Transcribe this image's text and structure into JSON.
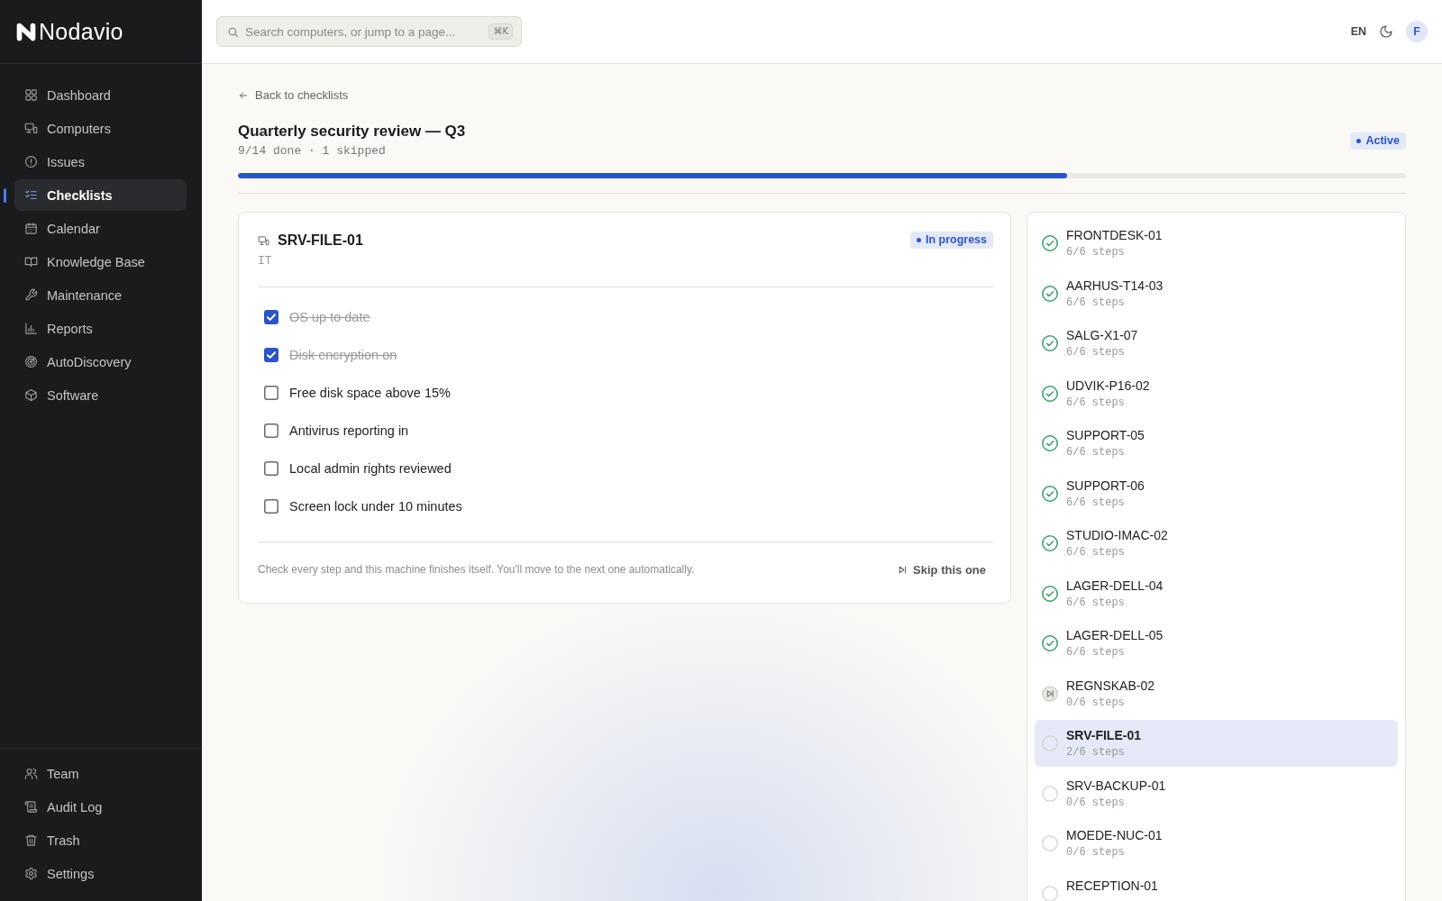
{
  "sidebar": {
    "brand": "Nodavio",
    "nav": [
      {
        "label": "Dashboard",
        "selected": false
      },
      {
        "label": "Computers",
        "selected": false
      },
      {
        "label": "Issues",
        "selected": false
      },
      {
        "label": "Checklists",
        "selected": true
      },
      {
        "label": "Calendar",
        "selected": false
      },
      {
        "label": "Knowledge Base",
        "selected": false
      },
      {
        "label": "Maintenance",
        "selected": false
      },
      {
        "label": "Reports",
        "selected": false
      },
      {
        "label": "AutoDiscovery",
        "selected": false
      },
      {
        "label": "Software",
        "selected": false
      }
    ],
    "footer_nav": [
      {
        "label": "Team",
        "selected": false
      },
      {
        "label": "Audit Log",
        "selected": false
      },
      {
        "label": "Trash",
        "selected": false
      },
      {
        "label": "Settings",
        "selected": false
      }
    ]
  },
  "topbar": {
    "search": {
      "placeholder": "Search computers, or jump to a page...",
      "shortcut": "⌘K"
    },
    "language": "EN",
    "avatar": "F"
  },
  "header": {
    "back_link": "Back to checklists",
    "title": "Quarterly security review — Q3",
    "summary": "9/14 done · 1 skipped",
    "status": "Active",
    "progress": {
      "level": 0.71
    }
  },
  "machine": {
    "name": "SRV-FILE-01",
    "group": "IT",
    "status": "In progress",
    "steps": [
      {
        "label": "OS up to date",
        "checked": true
      },
      {
        "label": "Disk encryption on",
        "checked": true
      },
      {
        "label": "Free disk space above 15%",
        "checked": false
      },
      {
        "label": "Antivirus reporting in",
        "checked": false
      },
      {
        "label": "Local admin rights reviewed",
        "checked": false
      },
      {
        "label": "Screen lock under 10 minutes",
        "checked": false
      }
    ],
    "hint": "Check every step and this machine finishes itself. You'll move to the next one automatically.",
    "skip_button": "Skip this one"
  },
  "queue": [
    {
      "name": "FRONTDESK-01",
      "steps": "6/6 steps",
      "kind": "done",
      "selected": false
    },
    {
      "name": "AARHUS-T14-03",
      "steps": "6/6 steps",
      "kind": "done",
      "selected": false
    },
    {
      "name": "SALG-X1-07",
      "steps": "6/6 steps",
      "kind": "done",
      "selected": false
    },
    {
      "name": "UDVIK-P16-02",
      "steps": "6/6 steps",
      "kind": "done",
      "selected": false
    },
    {
      "name": "SUPPORT-05",
      "steps": "6/6 steps",
      "kind": "done",
      "selected": false
    },
    {
      "name": "SUPPORT-06",
      "steps": "6/6 steps",
      "kind": "done",
      "selected": false
    },
    {
      "name": "STUDIO-IMAC-02",
      "steps": "6/6 steps",
      "kind": "done",
      "selected": false
    },
    {
      "name": "LAGER-DELL-04",
      "steps": "6/6 steps",
      "kind": "done",
      "selected": false
    },
    {
      "name": "LAGER-DELL-05",
      "steps": "6/6 steps",
      "kind": "done",
      "selected": false
    },
    {
      "name": "REGNSKAB-02",
      "steps": "0/6 steps",
      "kind": "skipped",
      "selected": false
    },
    {
      "name": "SRV-FILE-01",
      "steps": "2/6 steps",
      "kind": "pending",
      "selected": true
    },
    {
      "name": "SRV-BACKUP-01",
      "steps": "0/6 steps",
      "kind": "pending",
      "selected": false
    },
    {
      "name": "MOEDE-NUC-01",
      "steps": "0/6 steps",
      "kind": "pending",
      "selected": false
    },
    {
      "name": "RECEPTION-01",
      "kind": "pending",
      "selected": false
    }
  ]
}
